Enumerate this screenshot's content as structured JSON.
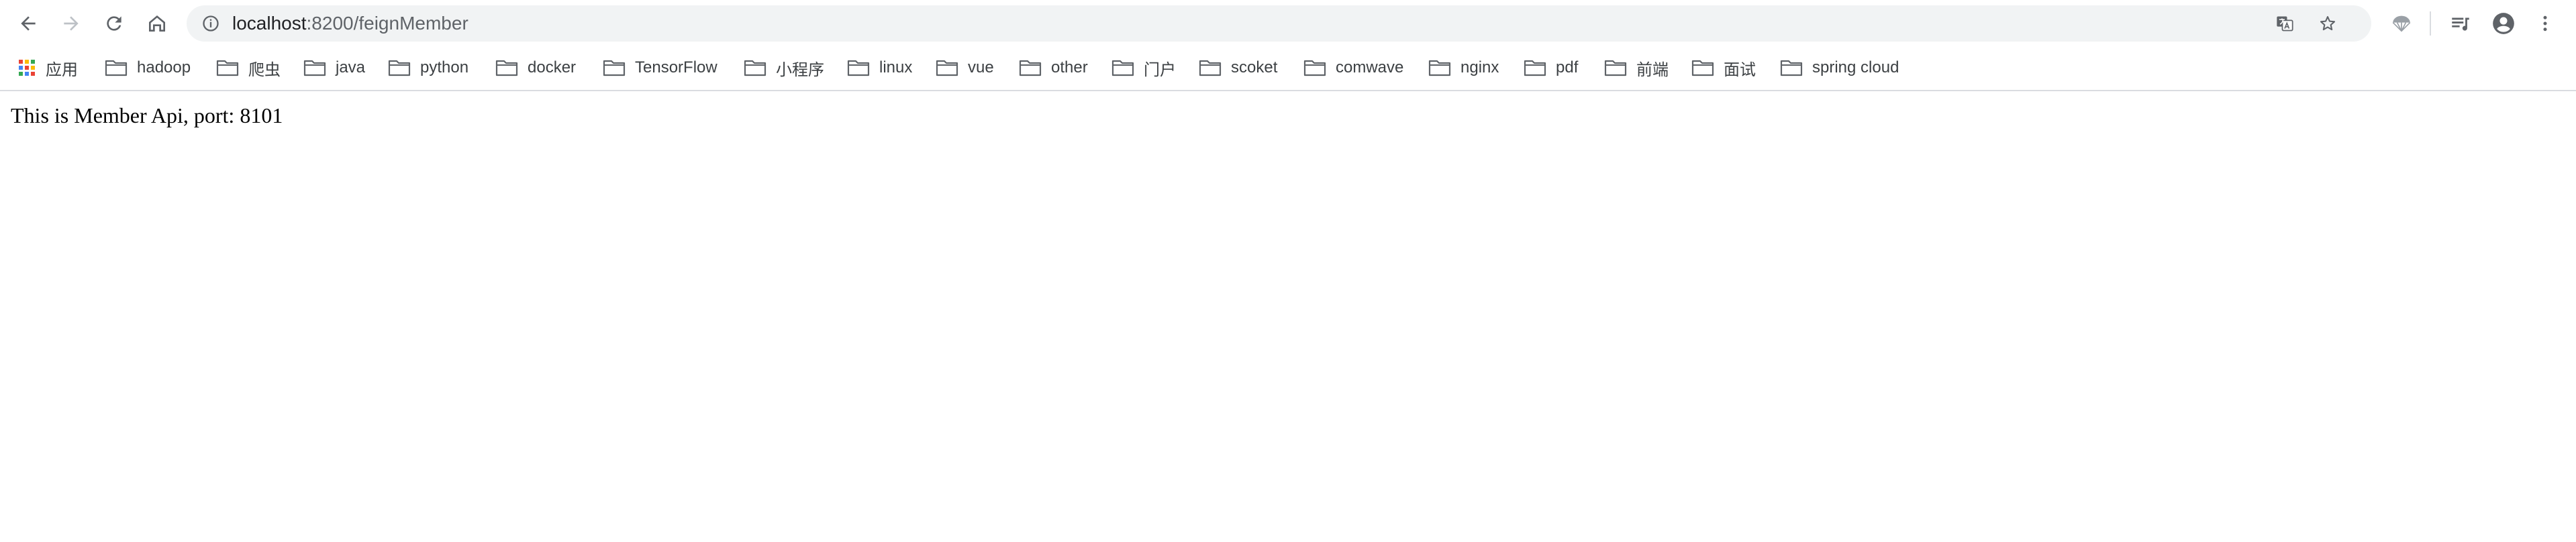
{
  "browser": {
    "address_bar": {
      "url_host": "localhost",
      "url_rest": ":8200/feignMember"
    },
    "bookmarks": {
      "apps_label": "应用",
      "items": [
        {
          "label": "hadoop"
        },
        {
          "label": "爬虫"
        },
        {
          "label": "java"
        },
        {
          "label": "python"
        },
        {
          "label": "docker"
        },
        {
          "label": "TensorFlow"
        },
        {
          "label": "小程序"
        },
        {
          "label": "linux"
        },
        {
          "label": "vue"
        },
        {
          "label": "other"
        },
        {
          "label": "门户"
        },
        {
          "label": "scoket"
        },
        {
          "label": "comwave"
        },
        {
          "label": "nginx"
        },
        {
          "label": "pdf"
        },
        {
          "label": "前端"
        },
        {
          "label": "面试"
        },
        {
          "label": "spring cloud"
        }
      ]
    }
  },
  "page": {
    "body_text": "This is Member Api, port: 8101"
  },
  "colors": {
    "toolbar_bg": "#ffffff",
    "omnibox_bg": "#f1f3f4",
    "icon": "#5f6368",
    "folder": "#5f6368"
  }
}
